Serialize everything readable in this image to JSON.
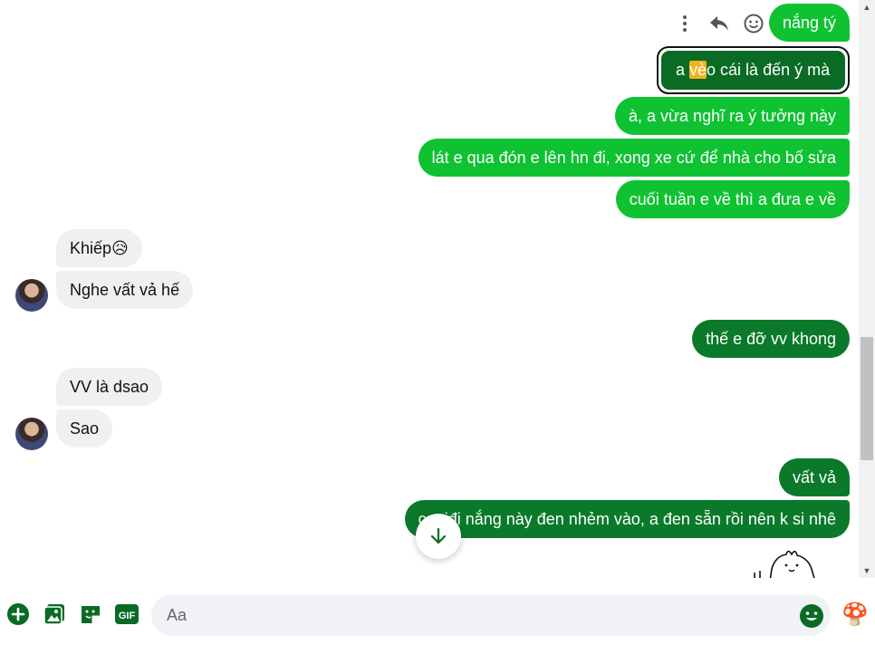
{
  "colors": {
    "accent": "#0a7a2a",
    "outgoing_light": "#0fc231",
    "outgoing_dark": "#0a7a2a",
    "incoming": "#f0f0f0",
    "highlight": "#f5b21d"
  },
  "message_tools": {
    "icons": [
      "more-vert-icon",
      "reply-icon",
      "smile-icon"
    ]
  },
  "messages": {
    "m1": "nắng tý",
    "m2": {
      "before": "a ",
      "highlight": "vè",
      "after": "o cái là đến ý mà"
    },
    "m3": "à, a vừa nghĩ ra ý tưởng này",
    "m4": "lát e qua đón e lên hn đi, xong xe cứ để nhà cho bố sửa",
    "m5": "cuối tuần e về thì a đưa e về",
    "in1": "Khiếp😥",
    "in2": "Nghe vất vả hế",
    "m6": "thế e đỡ vv khong",
    "in3": "VV là dsao",
    "in4": "Sao",
    "m7": "vất vả",
    "m8": "cgaiđi nắng này đen nhẻm vào, a đen sẵn rồi nên k si nhê"
  },
  "composer": {
    "placeholder": "Aa",
    "left_icons": [
      "plus-icon",
      "image-icon",
      "sticker-icon",
      "gif-icon"
    ],
    "gif_label": "GIF",
    "like_emoji": "🍄"
  }
}
